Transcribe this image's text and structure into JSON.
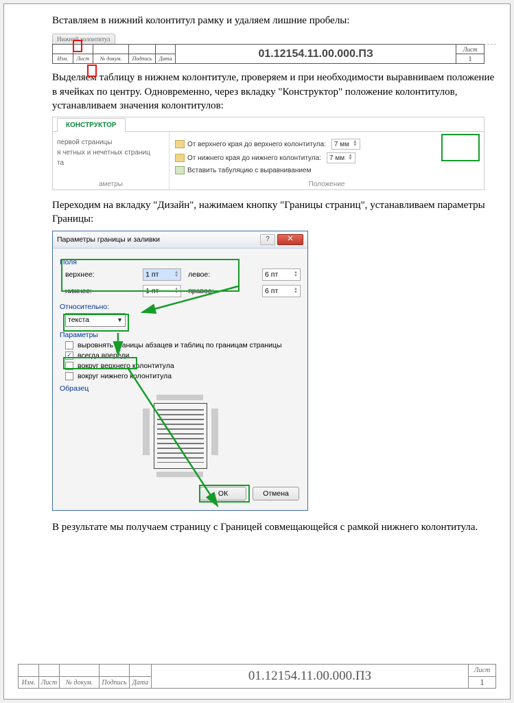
{
  "para1": "Вставляем в нижний колонтитул рамку и удаляем лишние пробелы:",
  "footer_tab": "Нижний колонтитул",
  "footer_small_cols": [
    "Изм.",
    "Лист",
    "№ докум.",
    "Подпись",
    "Дата"
  ],
  "footer_title": "01.12154.11.00.000.ПЗ",
  "footer_sheet_label": "Лист",
  "footer_sheet_num": "1",
  "para2": "Выделяем таблицу в нижнем колонтитуле, проверяем и при необходимости выравниваем положение в ячейках по центру. Одновременно, через вкладку \"Конструктор\" положение колонтитулов, устанавливаем значения колонтитулов:",
  "ribbon": {
    "tab": "КОНСТРУКТОР",
    "left_opts": [
      "первой страницы",
      "я четных и нечетных страниц",
      "та"
    ],
    "left_label": "аметры",
    "right_rows": [
      {
        "label": "От верхнего края до верхнего колонтитула:",
        "val": "7 мм"
      },
      {
        "label": "От нижнего края до нижнего колонтитула:",
        "val": "7 мм"
      }
    ],
    "row3": "Вставить табуляцию с выравниванием",
    "right_label": "Положение"
  },
  "para3": "Переходим на вкладку \"Дизайн\", нажимаем кнопку \"Границы страниц\", устанавливаем параметры Границы:",
  "dialog": {
    "title": "Параметры границы и заливки",
    "help": "?",
    "close": "✕",
    "fields_label": "Поля",
    "top_lbl": "верхнее:",
    "top_val": "1 пт",
    "left_lbl": "левое:",
    "left_val": "6 пт",
    "bottom_lbl": "нижнее:",
    "bottom_val": "1 пт",
    "right_lbl": "правое:",
    "right_val": "6 пт",
    "rel_label": "Относительно:",
    "rel_val": "текста",
    "params_label": "Параметры",
    "chk1": "выровнять границы абзацев и таблиц по границам страницы",
    "chk2": "всегда впереди",
    "chk3": "вокруг верхнего колонтитула",
    "chk4": "вокруг нижнего колонтитула",
    "preview_label": "Образец",
    "ok": "ОК",
    "cancel": "Отмена"
  },
  "para4": "В результате мы получаем страницу с Границей совмещающейся с рамкой нижнего колонтитула.",
  "stamp": {
    "cols": [
      "Изм.",
      "Лист",
      "№ докум.",
      "Подпись",
      "Дата"
    ],
    "title": "01.12154.11.00.000.ПЗ",
    "sheet_label": "Лист",
    "sheet_num": "1"
  }
}
